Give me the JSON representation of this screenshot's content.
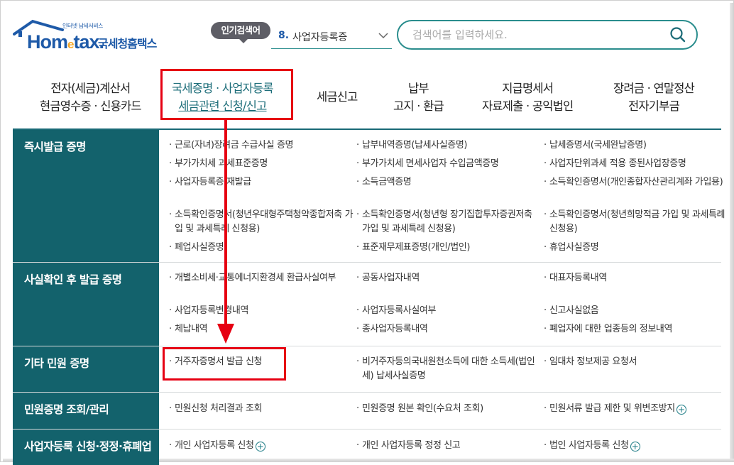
{
  "logo": {
    "small": "인터넷 납세서비스",
    "word": "Hom",
    "e": "e",
    "word2": "tax",
    "kr": "국세청홈택스"
  },
  "popular": {
    "badge": "인기검색어",
    "rank": "8.",
    "term": "사업자등록증"
  },
  "search": {
    "placeholder": "검색어를 입력하세요."
  },
  "nav": [
    {
      "l1": "전자(세금)계산서",
      "l2": "현금영수증 · 신용카드"
    },
    {
      "l1": "국세증명 · 사업자등록",
      "l2": "세금관련 신청/신고"
    },
    {
      "l1": "세금신고",
      "l2": ""
    },
    {
      "l1": "납부",
      "l2": "고지 · 환급"
    },
    {
      "l1": "지급명세서",
      "l2": "자료제출 · 공익법인"
    },
    {
      "l1": "장려금 · 연말정산",
      "l2": "전자기부금"
    }
  ],
  "rows": [
    {
      "head": "즉시발급 증명",
      "items": [
        [
          "근로(자녀)장려금 수급사실 증명",
          "납부내역증명(납세사실증명)",
          "납세증명서(국세완납증명)"
        ],
        [
          "부가가치세 과세표준증명",
          "부가가치세 면세사업자 수입금액증명",
          "사업자단위과세 적용 종된사업장증명"
        ],
        [
          "사업자등록증 재발급",
          "소득금액증명",
          "소득확인증명서(개인종합자산관리계좌 가입용)"
        ],
        [
          "소득확인증명서(청년우대형주택청약종합저축 가입 및 과세특례 신청용)",
          "소득확인증명서(청년형 장기집합투자증권저축 가입 및 과세특례 신청용)",
          "소득확인증명서(청년희망적금 가입 및 과세특례 신청용)"
        ],
        [
          "폐업사실증명",
          "표준재무제표증명(개인/법인)",
          "휴업사실증명"
        ]
      ]
    },
    {
      "head": "사실확인 후 발급 증명",
      "items": [
        [
          "개별소비세·교통에너지환경세 환급사실여부",
          "공동사업자내역",
          "대표자등록내역"
        ],
        [
          "사업자등록변경내역",
          "사업자등록사실여부",
          "신고사실없음"
        ],
        [
          "체납내역",
          "종사업자등록내역",
          "폐업자에 대한 업종등의 정보내역"
        ]
      ]
    },
    {
      "head": "기타 민원 증명",
      "items": [
        [
          "거주자증명서 발급 신청",
          "비거주자등의국내원천소득에 대한 소득세(법인세) 납세사실증명",
          "임대차 정보제공 요청서"
        ]
      ]
    },
    {
      "head": "민원증명 조회/관리",
      "items": [
        [
          "민원신청 처리결과 조회",
          "민원증명 원본 확인(수요처 조회)",
          "민원서류 발급 제한 및 위변조방지"
        ]
      ]
    },
    {
      "head": "사업자등록 신청·정정·휴폐업",
      "items": [
        [
          "개인 사업자등록 신청",
          "개인 사업자등록 정정 신고",
          "법인 사업자등록 신청"
        ]
      ]
    }
  ]
}
